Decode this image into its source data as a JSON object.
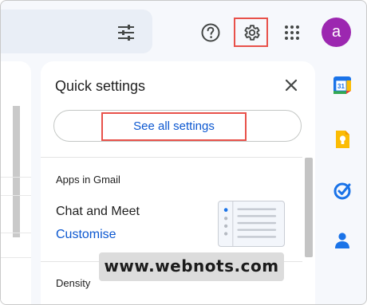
{
  "header": {
    "avatar_letter": "a",
    "icons": [
      "search-options-icon",
      "help-icon",
      "settings-gear-icon",
      "apps-grid-icon"
    ],
    "highlight_color": "#e8514a",
    "avatar_color": "#9c27b0"
  },
  "quick_settings": {
    "title": "Quick settings",
    "see_all_label": "See all settings",
    "apps_section_label": "Apps in Gmail",
    "chat_label": "Chat and Meet",
    "customise_label": "Customise",
    "density_label": "Density",
    "link_color": "#0b57d0"
  },
  "side_panel": {
    "icons": [
      "calendar-icon",
      "keep-icon",
      "tasks-icon",
      "contacts-icon"
    ],
    "calendar_day": "31"
  },
  "watermark": {
    "text": "www.webnots.com"
  }
}
